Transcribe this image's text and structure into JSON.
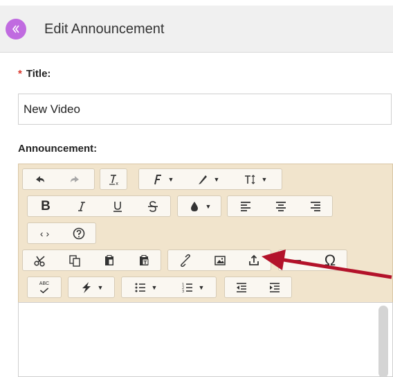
{
  "header": {
    "title": "Edit Announcement",
    "back_icon": "double-chevron-left-icon",
    "accent": "#c06be0"
  },
  "form": {
    "title_label": "Title:",
    "required_marker": "*",
    "title_value": "New Video",
    "announcement_label": "Announcement:"
  },
  "toolbar": {
    "rows": [
      [
        "undo-icon",
        "redo-icon",
        "clear-formatting-icon",
        "font-family-icon",
        "font-style-icon",
        "font-size-icon"
      ],
      [
        "bold-icon",
        "italic-icon",
        "underline-icon",
        "strikethrough-icon",
        "text-color-icon",
        "align-left-icon",
        "align-center-icon",
        "align-right-icon"
      ],
      [
        "source-code-icon",
        "help-icon"
      ],
      [
        "cut-icon",
        "copy-icon",
        "paste-icon",
        "paste-text-icon",
        "link-icon",
        "image-icon",
        "upload-icon",
        "horizontal-rule-icon",
        "special-character-icon"
      ],
      [
        "spellcheck-icon",
        "insert-icon",
        "bullet-list-icon",
        "numbered-list-icon",
        "outdent-icon",
        "indent-icon"
      ]
    ],
    "spellcheck_text": "ABC",
    "panel_color": "#f1e4cc"
  },
  "annotation": {
    "arrow_color": "#b3122a",
    "points_to": "upload-icon"
  }
}
